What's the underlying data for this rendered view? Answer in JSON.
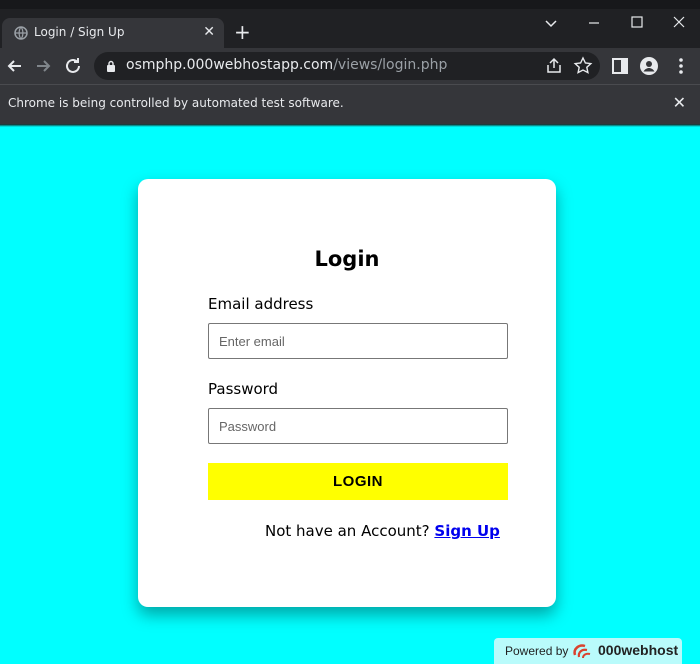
{
  "browser": {
    "tab_title": "Login / Sign Up",
    "new_tab_symbol": "+",
    "url_host": "osmphp.000webhostapp.com",
    "url_path": "/views/login.php",
    "infobar_text": "Chrome is being controlled by automated test software.",
    "icons": [
      "globe-icon",
      "close-icon",
      "back-icon",
      "forward-icon",
      "reload-icon",
      "lock-icon",
      "share-icon",
      "star-icon",
      "side-panel-icon",
      "profile-icon",
      "menu-icon",
      "minimize-icon",
      "maximize-icon",
      "tab-search-icon"
    ]
  },
  "login": {
    "heading": "Login",
    "email_label": "Email address",
    "email_placeholder": "Enter email",
    "email_value": "",
    "password_label": "Password",
    "password_placeholder": "Password",
    "password_value": "",
    "button_label": "LOGIN",
    "signup_prompt": "Not have an Account?",
    "signup_link": "Sign Up"
  },
  "badge": {
    "label": "Powered by",
    "brand": "000webhost"
  },
  "colors": {
    "page_background": "#00ffff",
    "button_background": "#ffff00",
    "link": "#0000ee"
  }
}
